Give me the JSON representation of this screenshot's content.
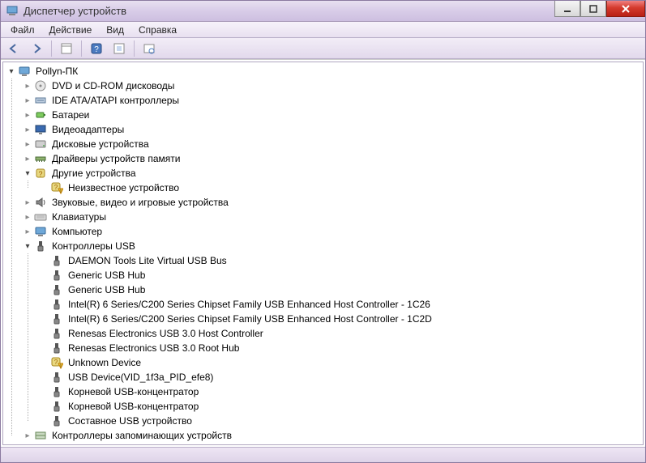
{
  "window": {
    "title": "Диспетчер устройств"
  },
  "menu": {
    "file": "Файл",
    "action": "Действие",
    "view": "Вид",
    "help": "Справка"
  },
  "tree": {
    "root": "Pollyn-ПК",
    "items": [
      {
        "label": "DVD и CD-ROM дисководы",
        "icon": "disc",
        "expanded": false
      },
      {
        "label": "IDE ATA/ATAPI контроллеры",
        "icon": "ide",
        "expanded": false
      },
      {
        "label": "Батареи",
        "icon": "battery",
        "expanded": false
      },
      {
        "label": "Видеоадаптеры",
        "icon": "display",
        "expanded": false
      },
      {
        "label": "Дисковые устройства",
        "icon": "hdd",
        "expanded": false
      },
      {
        "label": "Драйверы устройств памяти",
        "icon": "mem",
        "expanded": false
      },
      {
        "label": "Другие устройства",
        "icon": "other",
        "expanded": true,
        "children": [
          {
            "label": "Неизвестное устройство",
            "icon": "unknown-warn"
          }
        ]
      },
      {
        "label": "Звуковые, видео и игровые устройства",
        "icon": "sound",
        "expanded": false
      },
      {
        "label": "Клавиатуры",
        "icon": "keyboard",
        "expanded": false
      },
      {
        "label": "Компьютер",
        "icon": "computer",
        "expanded": false
      },
      {
        "label": "Контроллеры USB",
        "icon": "usb",
        "expanded": true,
        "children": [
          {
            "label": "DAEMON Tools Lite Virtual USB Bus",
            "icon": "usb"
          },
          {
            "label": "Generic USB Hub",
            "icon": "usb"
          },
          {
            "label": "Generic USB Hub",
            "icon": "usb"
          },
          {
            "label": "Intel(R) 6 Series/C200 Series Chipset Family USB Enhanced Host Controller - 1C26",
            "icon": "usb"
          },
          {
            "label": "Intel(R) 6 Series/C200 Series Chipset Family USB Enhanced Host Controller - 1C2D",
            "icon": "usb"
          },
          {
            "label": "Renesas Electronics USB 3.0 Host Controller",
            "icon": "usb"
          },
          {
            "label": "Renesas Electronics USB 3.0 Root Hub",
            "icon": "usb"
          },
          {
            "label": "Unknown Device",
            "icon": "unknown-warn"
          },
          {
            "label": "USB Device(VID_1f3a_PID_efe8)",
            "icon": "usb"
          },
          {
            "label": "Корневой USB-концентратор",
            "icon": "usb"
          },
          {
            "label": "Корневой USB-концентратор",
            "icon": "usb"
          },
          {
            "label": "Составное USB устройство",
            "icon": "usb"
          }
        ]
      },
      {
        "label": "Контроллеры запоминающих устройств",
        "icon": "storage",
        "expanded": false
      }
    ]
  }
}
